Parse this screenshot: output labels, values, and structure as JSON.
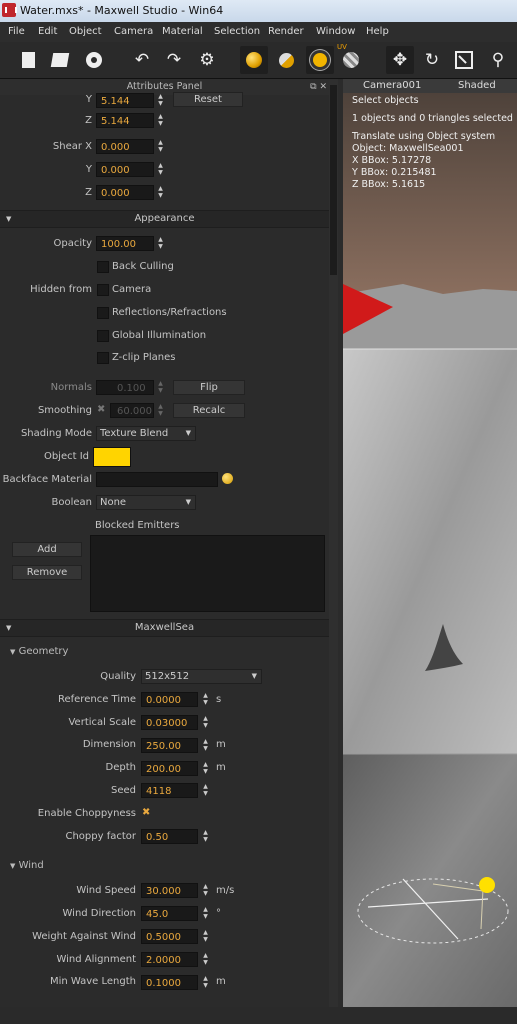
{
  "window": {
    "title": "Water.mxs* - Maxwell Studio - Win64"
  },
  "menu": [
    "File",
    "Edit",
    "Object",
    "Camera",
    "Material",
    "Selection",
    "Render",
    "Window",
    "Help"
  ],
  "toolbar": {
    "icons": [
      "new-scene-icon",
      "open-icon",
      "save-icon",
      "undo-icon",
      "redo-icon",
      "settings-icon",
      "render-sphere-icon",
      "material-ball-icon",
      "light-emitter-icon",
      "uv-icon",
      "move-icon",
      "rotate-icon",
      "scale-icon",
      "pin-icon"
    ]
  },
  "attributes_panel": {
    "title": "Attributes Panel",
    "transform": {
      "y_value": "5.144",
      "z_value": "5.144",
      "reset_label": "Reset",
      "shear_label": "Shear X",
      "shear_x": "0.000",
      "shear_y_label": "Y",
      "shear_y": "0.000",
      "shear_z_label": "Z",
      "shear_z": "0.000",
      "y_label": "Y",
      "z_label": "Z"
    },
    "appearance": {
      "title": "Appearance",
      "opacity_label": "Opacity",
      "opacity": "100.00",
      "back_culling": "Back Culling",
      "hidden_from_label": "Hidden from",
      "camera": "Camera",
      "reflections": "Reflections/Refractions",
      "gi": "Global Illumination",
      "zclip": "Z-clip Planes",
      "normals_label": "Normals",
      "normals": "0.100",
      "flip": "Flip",
      "smoothing_label": "Smoothing",
      "smoothing": "60.000",
      "recalc": "Recalc",
      "shading_mode_label": "Shading Mode",
      "shading_mode": "Texture Blend",
      "object_id_label": "Object Id",
      "object_id_color": "#ffd400",
      "backface_label": "Backface Material",
      "boolean_label": "Boolean",
      "boolean": "None",
      "blocked_emitters": "Blocked Emitters",
      "add": "Add",
      "remove": "Remove"
    },
    "maxwellsea": {
      "title": "MaxwellSea",
      "geometry_title": "Geometry",
      "quality_label": "Quality",
      "quality": "512x512",
      "ref_time_label": "Reference Time",
      "ref_time": "0.0000",
      "ref_time_unit": "s",
      "vscale_label": "Vertical Scale",
      "vscale": "0.03000",
      "dimension_label": "Dimension",
      "dimension": "250.00",
      "dimension_unit": "m",
      "depth_label": "Depth",
      "depth": "200.00",
      "depth_unit": "m",
      "seed_label": "Seed",
      "seed": "4118",
      "choppy_label": "Enable Choppyness",
      "choppy_factor_label": "Choppy factor",
      "choppy_factor": "0.50",
      "wind_title": "Wind",
      "wind_speed_label": "Wind Speed",
      "wind_speed": "30.000",
      "wind_speed_unit": "m/s",
      "wind_dir_label": "Wind Direction",
      "wind_dir": "45.0",
      "wind_dir_unit": "°",
      "weight_label": "Weight Against Wind",
      "weight": "0.5000",
      "align_label": "Wind Alignment",
      "align": "2.0000",
      "minwave_label": "Min Wave Length",
      "minwave": "0.1000",
      "minwave_unit": "m"
    }
  },
  "viewport": {
    "camera": "Camera001",
    "mode": "Shaded",
    "info": [
      "Select objects",
      "1 objects and 0 triangles selected",
      "Translate using Object system",
      "Object: MaxwellSea001",
      "X BBox: 5.17278",
      "Y BBox: 0.215481",
      "Z BBox: 5.1615"
    ]
  }
}
